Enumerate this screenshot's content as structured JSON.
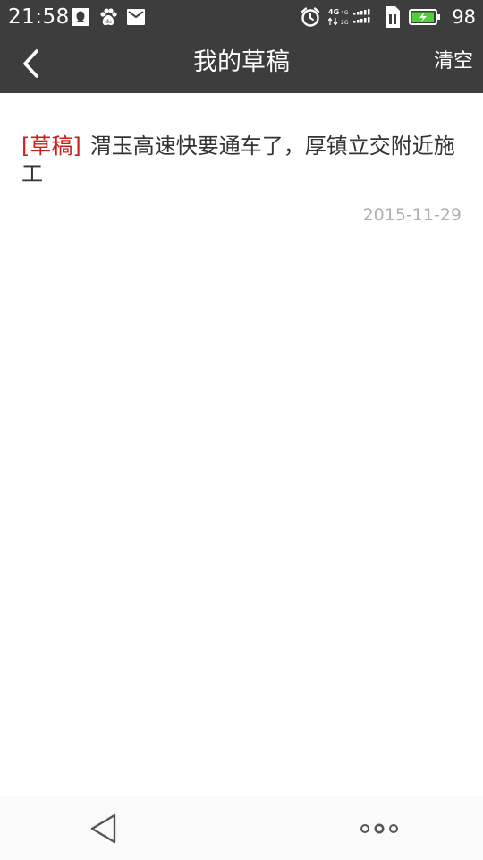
{
  "status_bar": {
    "time": "21:58",
    "battery_percent": "98",
    "left_icons": [
      "qq-icon",
      "baidu-icon",
      "mail-icon"
    ],
    "right_icons": [
      "alarm-icon",
      "network-4g-signal-icon",
      "sim-icon",
      "battery-charging-icon"
    ],
    "network_labels": [
      "4G",
      "4G",
      "2G"
    ],
    "battery_level": 0.98,
    "battery_color": "#4cd137"
  },
  "header": {
    "title": "我的草稿",
    "back_icon": "chevron-left-icon",
    "clear_label": "清空",
    "background": "#3d3d3d"
  },
  "drafts": [
    {
      "tag": "[草稿]",
      "text": "渭玉高速快要通车了，厚镇立交附近施工",
      "date": "2015-11-29"
    }
  ],
  "colors": {
    "tag": "#cc1f1a",
    "date": "#b0b0b0",
    "text": "#333333"
  },
  "nav_bar": {
    "back_icon": "triangle-back-icon",
    "menu_icon": "three-dots-menu-icon"
  }
}
